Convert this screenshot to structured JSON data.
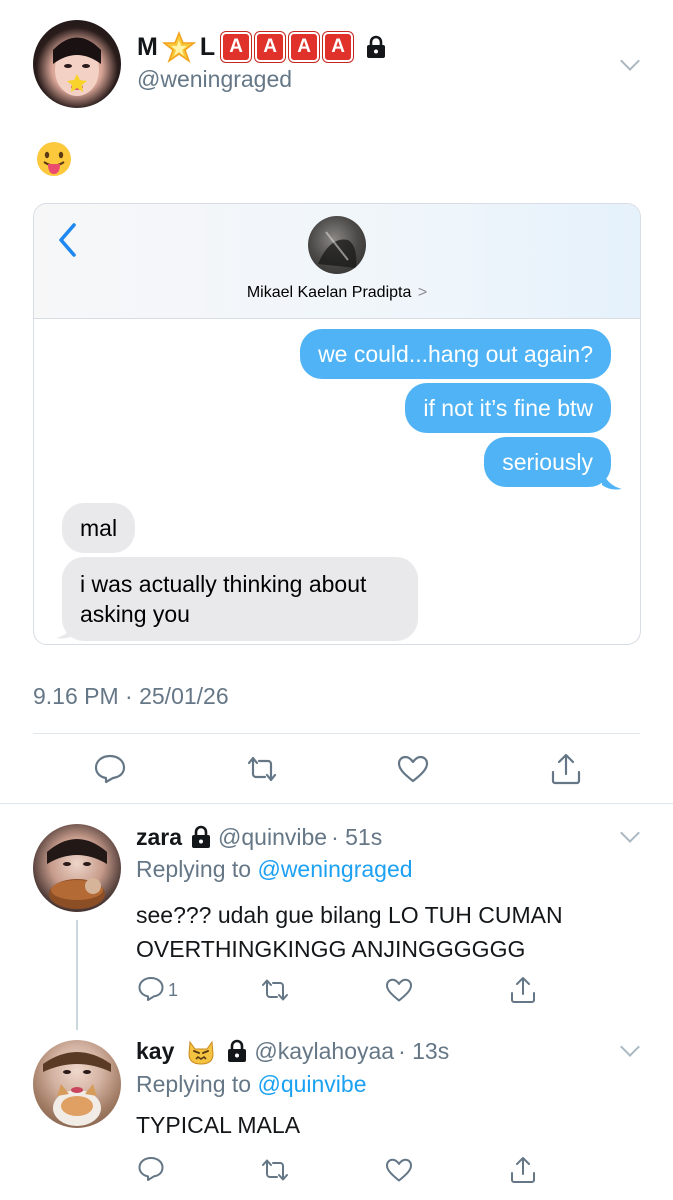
{
  "tweet": {
    "display_name_letters": [
      "M",
      "L"
    ],
    "badges": [
      "A",
      "A",
      "A",
      "A"
    ],
    "handle": "@weningraged",
    "emoji": "😛",
    "timestamp": "9.16 PM · 25/01/26"
  },
  "imessage": {
    "contact_name": "Mikael Kaelan Pradipta",
    "contact_chevron": ">",
    "sent": [
      "we could...hang out again?",
      "if not it’s fine btw",
      "seriously"
    ],
    "received": [
      "mal",
      "i was actually thinking about",
      "asking you"
    ]
  },
  "replies": [
    {
      "name": "zara",
      "handle": "@quinvibe",
      "time": "· 51s",
      "replying_label": "Replying to",
      "replying_to": "@weningraged",
      "text_line1": "see??? udah gue bilang LO TUH CUMAN",
      "text_line2": "OVERTHINGKINGG ANJINGGGGGG",
      "reply_count": "1"
    },
    {
      "name": "kay",
      "handle": "@kaylahoyaa",
      "time": "· 13s",
      "replying_label": "Replying to",
      "replying_to": "@quinvibe",
      "text_line1": "TYPICAL MALA"
    }
  ],
  "colors": {
    "accent": "#1da1f2",
    "bubble_blue": "#4fb3f5",
    "bubble_grey": "#e9e9eb",
    "text_grey": "#657786",
    "badge_red": "#e0312a"
  },
  "icons": [
    "reply-icon",
    "retweet-icon",
    "like-icon",
    "share-icon",
    "lock-icon",
    "star-emoji-icon",
    "cat-emoji-icon",
    "back-chevron-icon",
    "more-chevron-icon"
  ]
}
